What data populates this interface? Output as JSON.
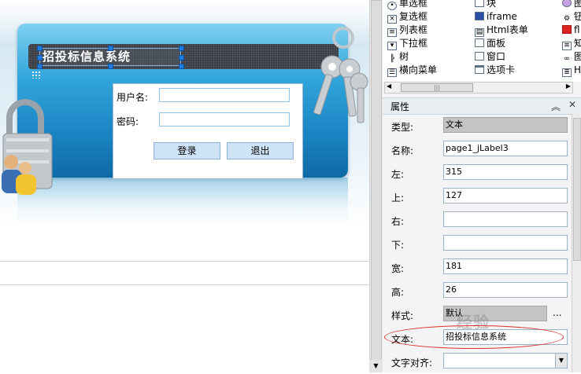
{
  "canvas": {
    "title_label": "招投标信息系统",
    "login_form": {
      "username_label": "用户名:",
      "password_label": "密码:",
      "username_value": "",
      "password_value": "",
      "login_button": "登录",
      "exit_button": "退出"
    }
  },
  "palette": {
    "col1": [
      {
        "label": "单选框",
        "icon": "radio-icon"
      },
      {
        "label": "复选框",
        "icon": "checkbox-icon"
      },
      {
        "label": "列表框",
        "icon": "listbox-icon"
      },
      {
        "label": "下拉框",
        "icon": "dropdown-icon"
      },
      {
        "label": "树",
        "icon": "tree-icon"
      },
      {
        "label": "横向菜单",
        "icon": "menu-icon"
      }
    ],
    "col2": [
      {
        "label": "块",
        "icon": "block-icon"
      },
      {
        "label": "iframe",
        "icon": "iframe-icon"
      },
      {
        "label": "Html表单",
        "icon": "html-form-icon"
      },
      {
        "label": "面板",
        "icon": "panel-icon"
      },
      {
        "label": "窗口",
        "icon": "window-icon"
      },
      {
        "label": "选项卡",
        "icon": "tab-icon"
      }
    ],
    "col3": [
      "图",
      "钮",
      "fl",
      "知",
      "图",
      "H"
    ]
  },
  "properties": {
    "header": "属性",
    "rows": [
      {
        "label": "类型:",
        "value": "文本",
        "style": "gray"
      },
      {
        "label": "名称:",
        "value": "page1_jLabel3",
        "style": "normal"
      },
      {
        "label": "左:",
        "value": "315",
        "style": "normal"
      },
      {
        "label": "上:",
        "value": "127",
        "style": "normal"
      },
      {
        "label": "右:",
        "value": "",
        "style": "normal"
      },
      {
        "label": "下:",
        "value": "",
        "style": "normal"
      },
      {
        "label": "宽:",
        "value": "181",
        "style": "normal"
      },
      {
        "label": "高:",
        "value": "26",
        "style": "normal"
      },
      {
        "label": "样式:",
        "value": "默认",
        "style": "gray-short"
      },
      {
        "label": "文本:",
        "value": "招投标信息系统",
        "style": "normal"
      },
      {
        "label": "文字对齐:",
        "value": "",
        "style": "select"
      }
    ],
    "style_button": "...",
    "watermark": "经验"
  },
  "colors": {
    "accent_blue": "#1b86c4",
    "selection_handle": "#1e7fe0",
    "highlight_ellipse": "#d9342b"
  }
}
